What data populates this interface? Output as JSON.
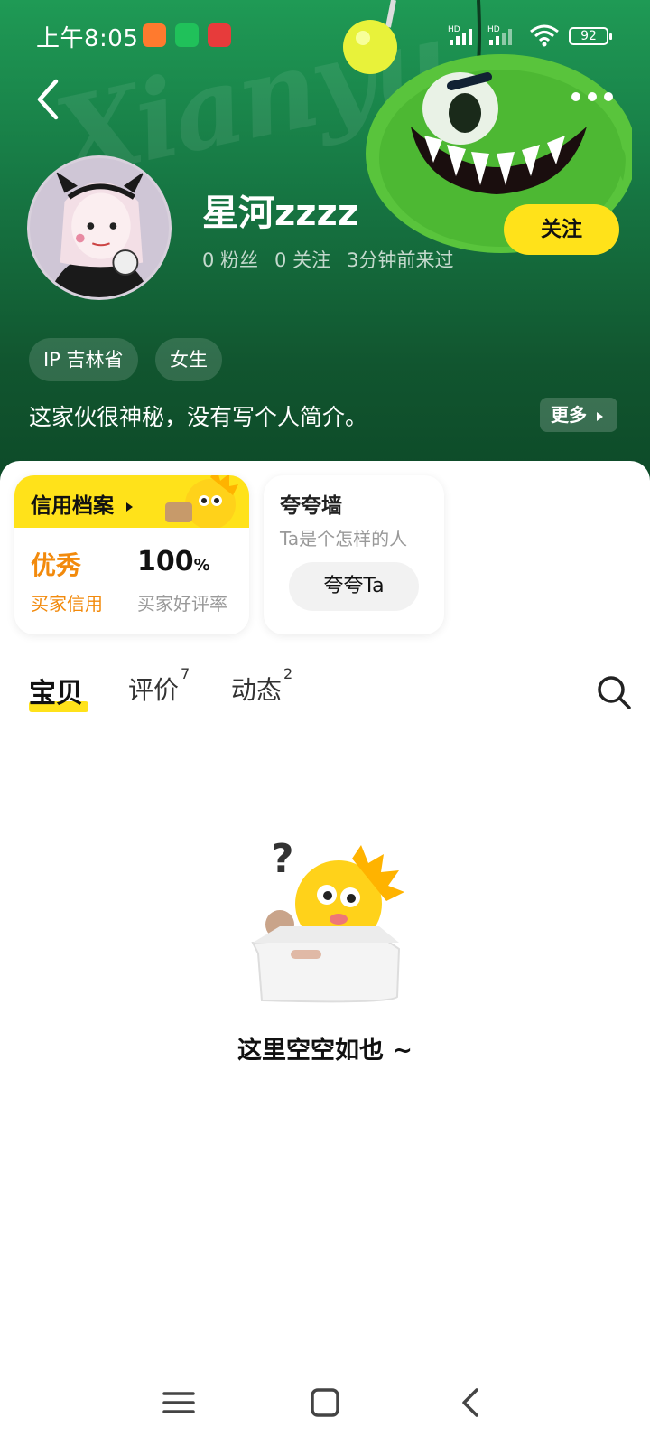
{
  "status_bar": {
    "time": "上午8:05",
    "battery": "92",
    "signal_labels": [
      "HD",
      "HD"
    ]
  },
  "header": {
    "watermark": "Xianyu",
    "username": "星河zzzz",
    "stats": [
      "0 粉丝",
      "0 关注",
      "3分钟前来过"
    ],
    "follow_label": "关注",
    "tags": [
      "IP 吉林省",
      "女生"
    ],
    "bio": "这家伙很神秘，没有写个人简介。",
    "more_label": "更多"
  },
  "credit": {
    "title": "信用档案",
    "grade": "优秀",
    "grade_label": "买家信用",
    "rate_value": "100",
    "rate_unit": "%",
    "rate_label": "买家好评率"
  },
  "praise": {
    "title": "夸夸墙",
    "subtitle": "Ta是个怎样的人",
    "button": "夸夸Ta"
  },
  "tabs": [
    {
      "label": "宝贝",
      "count": ""
    },
    {
      "label": "评价",
      "count": "7"
    },
    {
      "label": "动态",
      "count": "2"
    }
  ],
  "empty": {
    "message": "这里空空如也 ~"
  },
  "colors": {
    "accent_yellow": "#ffe21a",
    "header_green": "#1f9a55",
    "credit_orange": "#f28a0c"
  }
}
